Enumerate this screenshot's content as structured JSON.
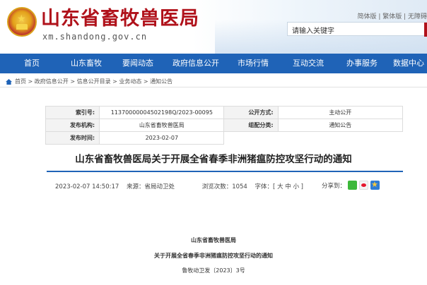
{
  "header": {
    "site_title": "山东省畜牧兽医局",
    "site_domain": "xm.shandong.gov.cn",
    "lang_links": "简体版 | 繁体版 | 无障碍",
    "search_placeholder": "请输入关键字",
    "colors": {
      "brand_red": "#b0121b",
      "nav_blue": "#1f63b7"
    }
  },
  "nav": {
    "items": [
      {
        "label": "首页"
      },
      {
        "label": "山东畜牧"
      },
      {
        "label": "要闻动态"
      },
      {
        "label": "政府信息公开"
      },
      {
        "label": "市场行情"
      },
      {
        "label": "互动交流"
      },
      {
        "label": "办事服务"
      },
      {
        "label": "数据中心"
      }
    ]
  },
  "breadcrumb": {
    "icon": "home-icon",
    "text": "首页 > 政府信息公开 > 信息公开目录 > 业务动态 > 通知公告"
  },
  "info_table": {
    "index_label": "索引号:",
    "index_value": "11370000004502198Q/2023-00095",
    "open_mode_label": "公开方式:",
    "open_mode_value": "主动公开",
    "publisher_label": "发布机构:",
    "publisher_value": "山东省畜牧兽医局",
    "category_label": "组配分类:",
    "category_value": "通知公告",
    "date_label": "发布时间:",
    "date_value": "2023-02-07"
  },
  "article": {
    "title": "山东省畜牧兽医局关于开展全省春季非洲猪瘟防控攻坚行动的通知",
    "datetime": "2023-02-07 14:50:17",
    "source": "来源：省局动卫处",
    "views": "浏览次数：1054",
    "font_size": "字体：[ 大 中 小 ]",
    "share_label": "分享到：",
    "body_org": "山东省畜牧兽医局",
    "body_title": "关于开展全省春季非洲猪瘟防控攻坚行动的通知",
    "body_doc_no": "鲁牧动卫发〔2023〕3号"
  }
}
